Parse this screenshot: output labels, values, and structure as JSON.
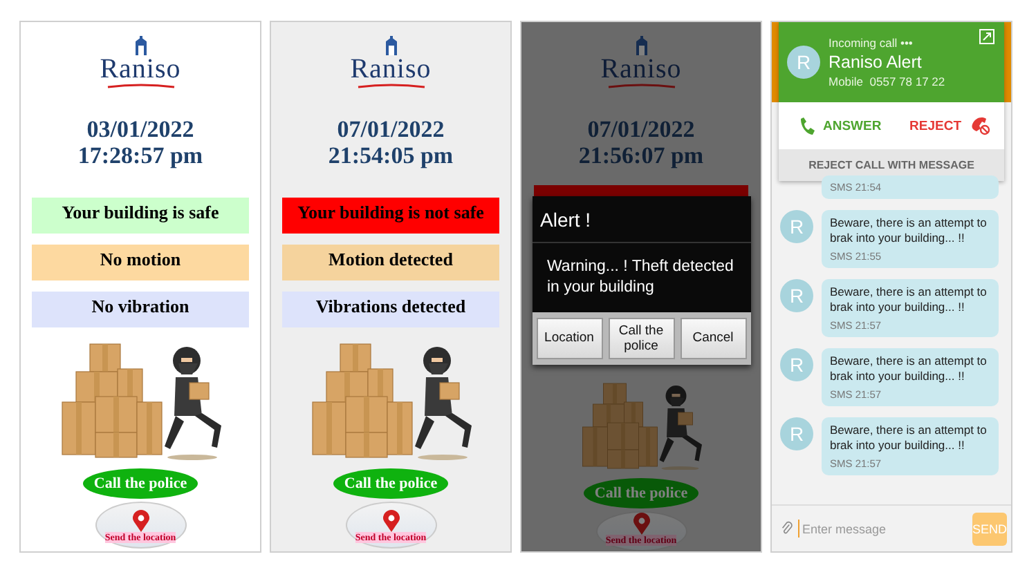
{
  "screens": [
    {
      "kind": "status",
      "logo": "Raniso",
      "date": "03/01/2022",
      "time": "17:28:57 pm",
      "statuses": [
        {
          "text": "Your building is safe",
          "color": "#ccffcc"
        },
        {
          "text": "No motion",
          "color": "#fdd9a0"
        },
        {
          "text": "No vibration",
          "color": "#dde3fb"
        }
      ],
      "call_button": "Call the police",
      "location_button": "Send the location"
    },
    {
      "kind": "status",
      "logo": "Raniso",
      "date": "07/01/2022",
      "time": "21:54:05 pm",
      "statuses": [
        {
          "text": "Your building is not safe",
          "color": "#ff0000"
        },
        {
          "text": "Motion detected",
          "color": "#f5d39d"
        },
        {
          "text": "Vibrations detected",
          "color": "#dde3fb"
        }
      ],
      "call_button": "Call the police",
      "location_button": "Send the location"
    },
    {
      "kind": "alert",
      "logo": "Raniso",
      "date": "07/01/2022",
      "time": "21:56:07 pm",
      "dialog": {
        "title": "Alert !",
        "message": "Warning... ! Theft detected in your building",
        "buttons": [
          "Location",
          "Call the police",
          "Cancel"
        ]
      },
      "call_button": "Call the police",
      "location_button": "Send the location"
    },
    {
      "kind": "sms",
      "call": {
        "status": "Incoming call •••",
        "avatar": "R",
        "caller": "Raniso Alert",
        "number_label": "Mobile",
        "number": "0557 78 17 22",
        "answer": "ANSWER",
        "reject": "REJECT",
        "reject_with_message": "REJECT CALL WITH MESSAGE"
      },
      "messages": [
        {
          "time": "SMS 21:54"
        },
        {
          "avatar": "R",
          "text": "Beware, there is an attempt to brak into your building... !!",
          "time": "SMS 21:55"
        },
        {
          "avatar": "R",
          "text": "Beware, there is an attempt to brak into your building... !!",
          "time": "SMS 21:57"
        },
        {
          "avatar": "R",
          "text": "Beware, there is an attempt to brak into your building... !!",
          "time": "SMS 21:57"
        },
        {
          "avatar": "R",
          "text": "Beware, there is an attempt to brak into your building... !!",
          "time": "SMS 21:57"
        }
      ],
      "composer": {
        "placeholder": "Enter message",
        "send": "SEND"
      }
    }
  ]
}
